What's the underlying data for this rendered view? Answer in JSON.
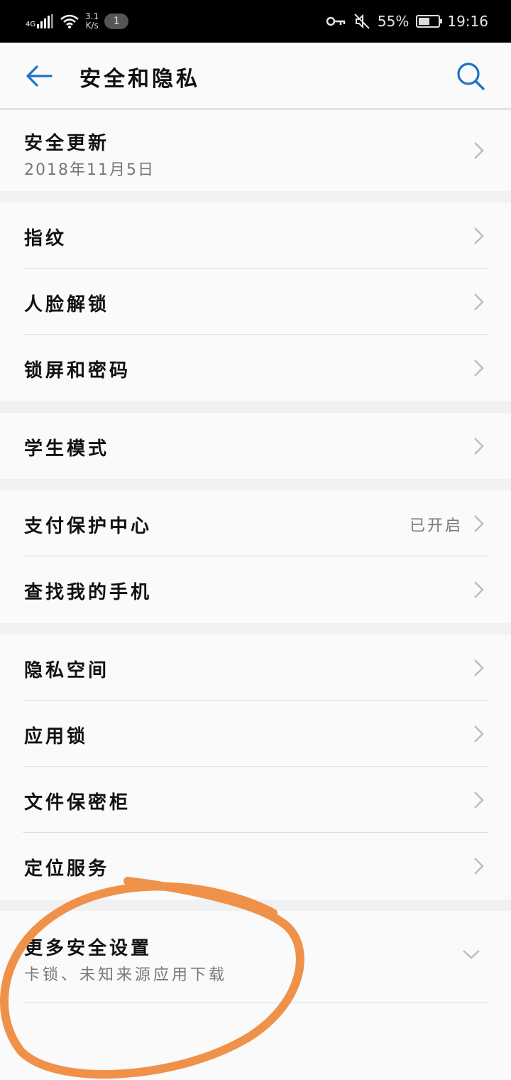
{
  "status_bar": {
    "network": "4G",
    "speed_value": "3.1",
    "speed_unit": "K/s",
    "notification_count": "1",
    "battery": "55%",
    "battery_level": 0.55,
    "time": "19:16"
  },
  "header": {
    "title": "安全和隐私"
  },
  "security_update": {
    "label": "安全更新",
    "date": "2018年11月5日"
  },
  "group_biometric": {
    "items": [
      {
        "label": "指纹"
      },
      {
        "label": "人脸解锁"
      },
      {
        "label": "锁屏和密码"
      }
    ]
  },
  "group_student": {
    "items": [
      {
        "label": "学生模式"
      }
    ]
  },
  "group_payment": {
    "items": [
      {
        "label": "支付保护中心",
        "status": "已开启"
      },
      {
        "label": "查找我的手机"
      }
    ]
  },
  "group_privacy": {
    "items": [
      {
        "label": "隐私空间"
      },
      {
        "label": "应用锁"
      },
      {
        "label": "文件保密柜"
      },
      {
        "label": "定位服务"
      }
    ]
  },
  "more_settings": {
    "label": "更多安全设置",
    "subtitle": "卡锁、未知来源应用下载"
  },
  "colors": {
    "accent": "#1a73c8",
    "annotation": "#f0914a"
  }
}
